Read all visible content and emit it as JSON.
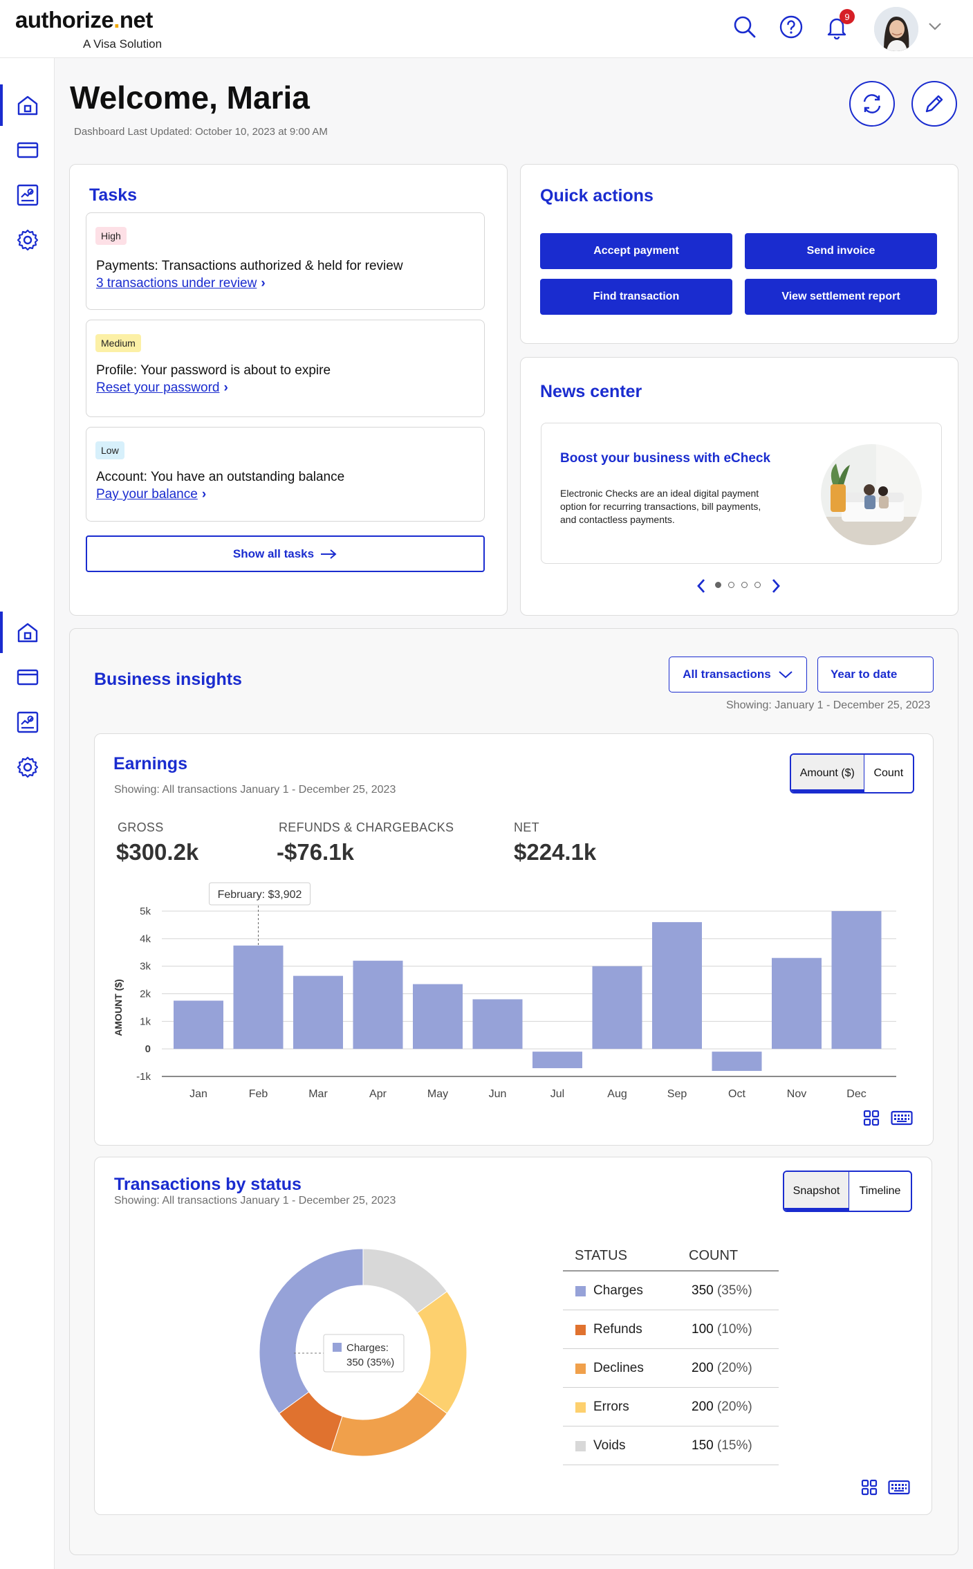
{
  "header": {
    "brand": "authorize.net",
    "tagline": "A Visa Solution",
    "notifications_count": "9"
  },
  "page": {
    "title": "Welcome, Maria",
    "last_updated": "Dashboard Last Updated: October 10, 2023 at 9:00 AM"
  },
  "tasks": {
    "title": "Tasks",
    "items": [
      {
        "priority": "High",
        "priority_color": "#fde0e6",
        "text": "Payments: Transactions authorized & held for review",
        "link": "3 transactions under review"
      },
      {
        "priority": "Medium",
        "priority_color": "#fcf0a6",
        "text": "Profile: Your password is about to expire",
        "link": "Reset your password"
      },
      {
        "priority": "Low",
        "priority_color": "#d7f0fb",
        "text": "Account: You have an outstanding balance",
        "link": "Pay your balance"
      }
    ],
    "show_all": "Show all tasks"
  },
  "quick_actions": {
    "title": "Quick actions",
    "buttons": [
      "Accept payment",
      "Send invoice",
      "Find transaction",
      "View settlement report"
    ]
  },
  "news": {
    "title": "News center",
    "headline": "Boost your business with eCheck",
    "body_lines": [
      "Electronic Checks are an ideal digital payment",
      "option for recurring transactions, bill payments,",
      "and contactless payments."
    ],
    "slides": 4,
    "active_slide": 1
  },
  "insights": {
    "title": "Business insights",
    "filter_type": "All transactions",
    "filter_range": "Year to date",
    "showing": "Showing: January 1 - December 25, 2023"
  },
  "earnings": {
    "title": "Earnings",
    "showing": "Showing: All transactions January 1 - December 25, 2023",
    "toggle": [
      "Amount ($)",
      "Count"
    ],
    "kpis": [
      {
        "label": "GROSS",
        "value": "$300.2k"
      },
      {
        "label": "REFUNDS & CHARGEBACKS",
        "value": "-$76.1k"
      },
      {
        "label": "NET",
        "value": "$224.1k"
      }
    ],
    "tooltip": "February: $3,902"
  },
  "chart_data": [
    {
      "type": "bar",
      "categories": [
        "Jan",
        "Feb",
        "Mar",
        "Apr",
        "May",
        "Jun",
        "Jul",
        "Aug",
        "Sep",
        "Oct",
        "Nov",
        "Dec"
      ],
      "values": [
        1750,
        3750,
        2650,
        3200,
        2350,
        1800,
        -700,
        3000,
        4600,
        -800,
        3300,
        5000
      ],
      "ylabel": "AMOUNT ($)",
      "yticks": [
        "5k",
        "4k",
        "3k",
        "2k",
        "1k",
        "0",
        "-1k"
      ],
      "ylim": [
        -1000,
        5000
      ],
      "bar_color": "#96a2d8",
      "grid": true
    },
    {
      "type": "pie",
      "title": "Transactions by status",
      "categories": [
        "Charges",
        "Refunds",
        "Declines",
        "Errors",
        "Voids"
      ],
      "values": [
        350,
        100,
        200,
        200,
        150
      ],
      "percents": [
        "35%",
        "10%",
        "20%",
        "20%",
        "15%"
      ],
      "colors": [
        "#96a2d8",
        "#e0722f",
        "#f0a04b",
        "#fdd06e",
        "#d8d8d8"
      ],
      "center_tooltip": [
        "Charges:",
        "350 (35%)"
      ]
    }
  ],
  "status": {
    "title": "Transactions by status",
    "showing": "Showing: All transactions January 1 - December 25, 2023",
    "toggle": [
      "Snapshot",
      "Timeline"
    ],
    "col_status": "STATUS",
    "col_count": "COUNT",
    "rows": [
      {
        "name": "Charges",
        "count": "350",
        "pct": "(35%)",
        "color": "#96a2d8"
      },
      {
        "name": "Refunds",
        "count": "100",
        "pct": "(10%)",
        "color": "#e0722f"
      },
      {
        "name": "Declines",
        "count": "200",
        "pct": "(20%)",
        "color": "#f0a04b"
      },
      {
        "name": "Errors",
        "count": "200",
        "pct": "(20%)",
        "color": "#fdd06e"
      },
      {
        "name": "Voids",
        "count": "150",
        "pct": "(15%)",
        "color": "#d8d8d8"
      }
    ]
  }
}
